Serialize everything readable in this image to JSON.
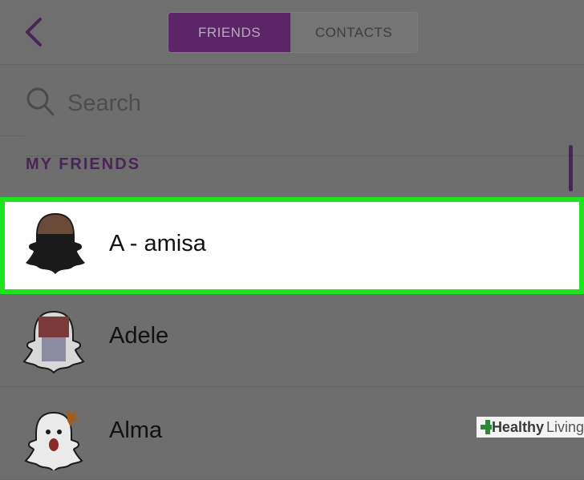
{
  "header": {
    "tabs": [
      {
        "label": "FRIENDS",
        "active": true
      },
      {
        "label": "CONTACTS",
        "active": false
      }
    ]
  },
  "search": {
    "placeholder": "Search"
  },
  "section": {
    "title": "MY FRIENDS"
  },
  "friends": [
    {
      "name": "A - amisa",
      "highlighted": true
    },
    {
      "name": "Adele",
      "highlighted": false
    },
    {
      "name": "Alma",
      "highlighted": false
    }
  ],
  "watermark": {
    "brand": "Healthy",
    "suffix": "Living"
  },
  "colors": {
    "accent": "#5b2568",
    "highlight": "#1ee31e"
  },
  "icons": [
    "back-chevron-icon",
    "search-icon",
    "ghost-avatar-icon",
    "plus-logo-icon"
  ]
}
